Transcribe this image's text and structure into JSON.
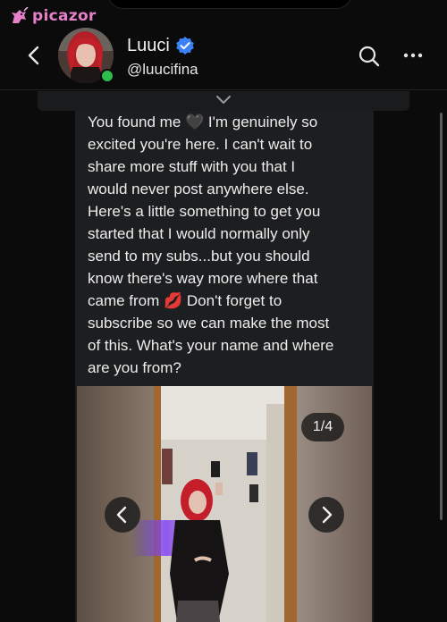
{
  "watermark": {
    "text": "picazor",
    "icon": "unicorn-icon"
  },
  "header": {
    "name": "Luuci",
    "handle": "@luucifina",
    "verified": true,
    "icons": [
      "back-arrow-icon",
      "search-icon",
      "more-icon"
    ],
    "online_color": "#2fbd4e"
  },
  "message": {
    "text": "You found me 🖤 I'm genuinely so\nexcited you're here. I can't wait to\nshare more stuff with you that I\nwould never post anywhere else.\nHere's a little something to get you\nstarted that I would normally only\nsend to my subs...but you should\nknow there's way more where that\ncame from 💋 Don't forget to\nsubscribe so we can make the most\nof this. What's your name and where\nare you from?"
  },
  "media": {
    "counter": "1/4",
    "icons": [
      "prev-arrow-icon",
      "next-arrow-icon"
    ]
  },
  "colors": {
    "background": "#0b0b0c",
    "bubble": "#1d1e20",
    "verified": "#3b82f6",
    "watermark": "#e680c9"
  }
}
